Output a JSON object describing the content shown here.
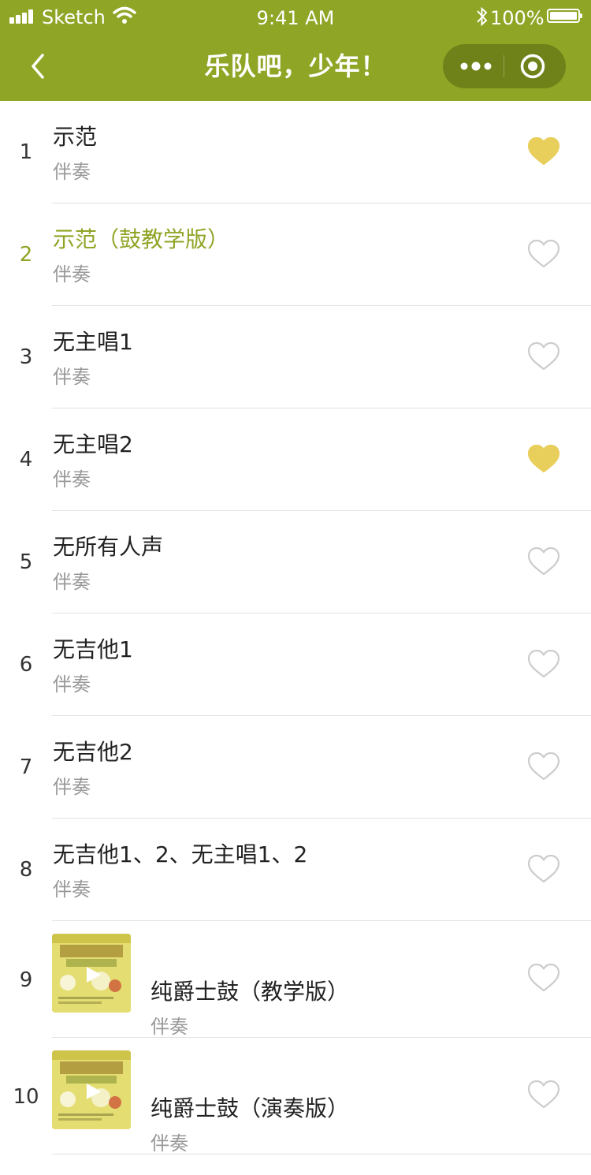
{
  "status_bar": {
    "carrier": "Sketch",
    "time": "9:41 AM",
    "battery": "100%"
  },
  "nav": {
    "title": "乐队吧，少年！",
    "back_icon": "chevron-left-icon",
    "more_icon": "more-dots-icon",
    "close_icon": "target-circle-icon"
  },
  "colors": {
    "brand": "#8fa526",
    "capsule": "#6f8219",
    "heart_filled": "#e8cf5b",
    "heart_outline": "#cccccc"
  },
  "tracks": [
    {
      "num": "1",
      "name": "示范",
      "sub": "伴奏",
      "favorited": true,
      "active": false,
      "thumbnail": false
    },
    {
      "num": "2",
      "name": "示范（鼓教学版）",
      "sub": "伴奏",
      "favorited": false,
      "active": true,
      "thumbnail": false
    },
    {
      "num": "3",
      "name": "无主唱1",
      "sub": "伴奏",
      "favorited": false,
      "active": false,
      "thumbnail": false
    },
    {
      "num": "4",
      "name": "无主唱2",
      "sub": "伴奏",
      "favorited": true,
      "active": false,
      "thumbnail": false
    },
    {
      "num": "5",
      "name": "无所有人声",
      "sub": "伴奏",
      "favorited": false,
      "active": false,
      "thumbnail": false
    },
    {
      "num": "6",
      "name": "无吉他1",
      "sub": "伴奏",
      "favorited": false,
      "active": false,
      "thumbnail": false
    },
    {
      "num": "7",
      "name": "无吉他2",
      "sub": "伴奏",
      "favorited": false,
      "active": false,
      "thumbnail": false
    },
    {
      "num": "8",
      "name": "无吉他1、2、无主唱1、2",
      "sub": "伴奏",
      "favorited": false,
      "active": false,
      "thumbnail": false
    },
    {
      "num": "9",
      "name": "纯爵士鼓（教学版）",
      "sub": "伴奏",
      "favorited": false,
      "active": false,
      "thumbnail": true
    },
    {
      "num": "10",
      "name": "纯爵士鼓（演奏版）",
      "sub": "伴奏",
      "favorited": false,
      "active": false,
      "thumbnail": true
    }
  ]
}
